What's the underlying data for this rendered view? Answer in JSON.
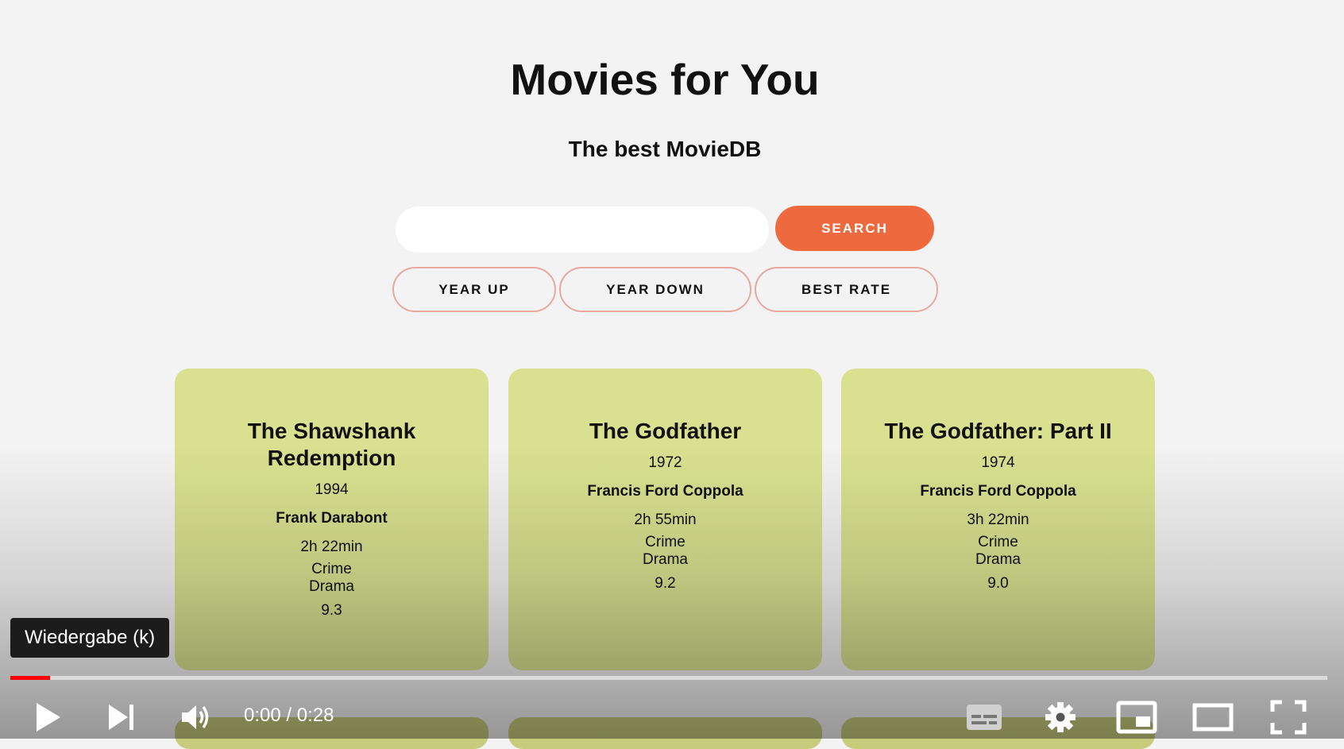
{
  "header": {
    "title": "Movies for You",
    "subtitle": "The best MovieDB"
  },
  "search": {
    "value": "",
    "placeholder": "",
    "button_label": "SEARCH"
  },
  "sort_buttons": [
    "YEAR UP",
    "YEAR DOWN",
    "BEST RATE"
  ],
  "movies": [
    {
      "title": "The Shawshank Redemption",
      "year": "1994",
      "director": "Frank Darabont",
      "runtime": "2h 22min",
      "genres": [
        "Crime",
        "Drama"
      ],
      "rating": "9.3"
    },
    {
      "title": "The Godfather",
      "year": "1972",
      "director": "Francis Ford Coppola",
      "runtime": "2h 55min",
      "genres": [
        "Crime",
        "Drama"
      ],
      "rating": "9.2"
    },
    {
      "title": "The Godfather: Part II",
      "year": "1974",
      "director": "Francis Ford Coppola",
      "runtime": "3h 22min",
      "genres": [
        "Crime",
        "Drama"
      ],
      "rating": "9.0"
    }
  ],
  "player": {
    "tooltip": "Wiedergabe (k)",
    "time_display": "0:00 / 0:28",
    "progress_fraction": 0.03,
    "progress_color": "#ff0000",
    "icons": [
      "play-icon",
      "next-icon",
      "volume-icon",
      "subtitles-icon",
      "settings-icon",
      "miniplayer-icon",
      "theater-icon",
      "fullscreen-icon"
    ]
  },
  "colors": {
    "accent": "#ee6a3e",
    "card": "#d9e190",
    "sort_border": "#e8a8a0"
  }
}
